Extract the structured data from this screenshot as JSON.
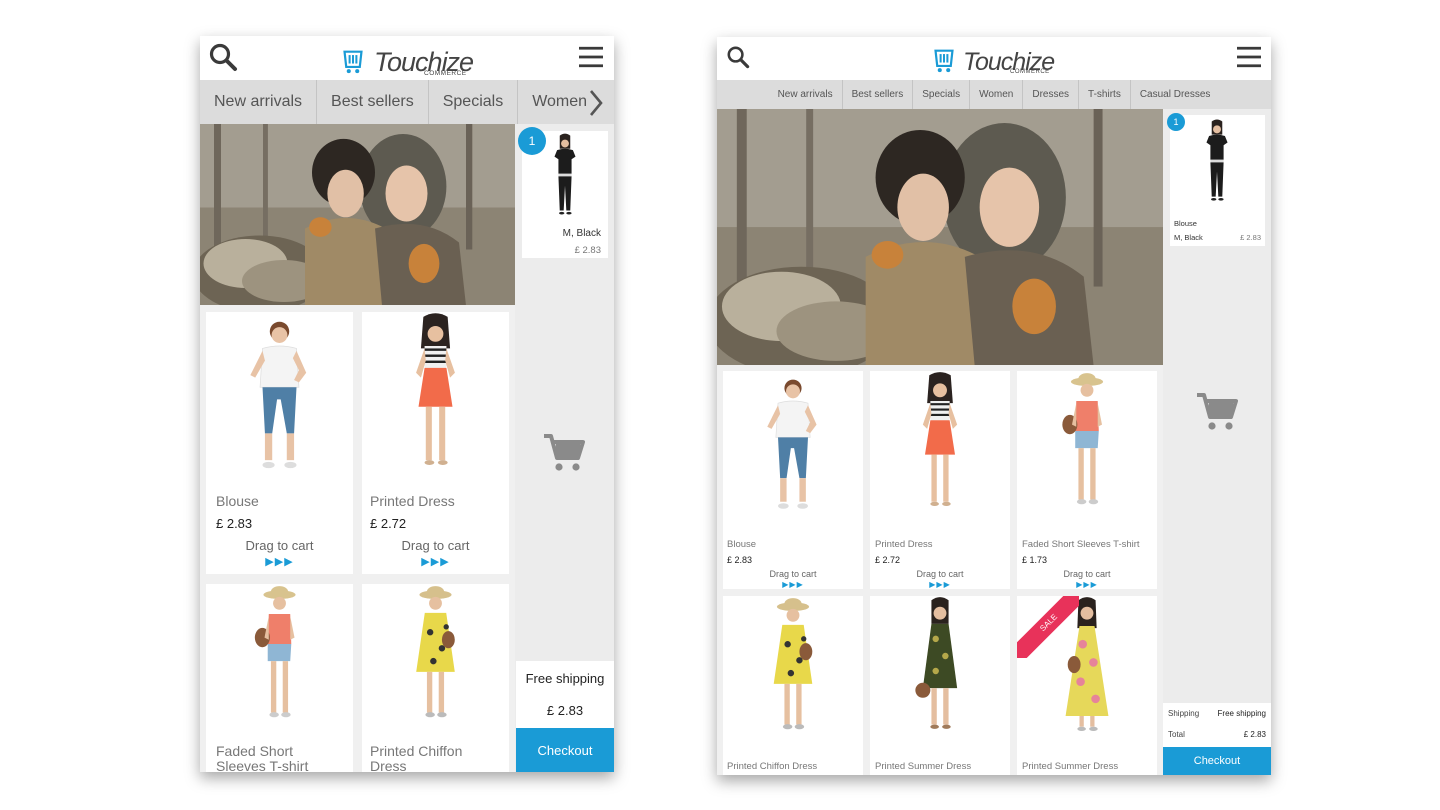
{
  "brand": {
    "name": "Touchize",
    "tagline": "COMMERCE"
  },
  "colors": {
    "accent": "#1a9bd6",
    "sale": "#e8325a",
    "navbar": "#dcdcdc",
    "panel": "#ececec"
  },
  "icons": {
    "search": "search-icon",
    "menu": "hamburger-menu-icon",
    "cart": "shopping-cart-icon",
    "next": "chevron-right-icon"
  },
  "phone": {
    "nav": [
      "New arrivals",
      "Best sellers",
      "Specials",
      "Women"
    ],
    "products": [
      {
        "name": "Blouse",
        "price": "£ 2.83",
        "drag": "Drag to cart",
        "arrows": "▶▶▶"
      },
      {
        "name": "Printed Dress",
        "price": "£ 2.72",
        "drag": "Drag to cart",
        "arrows": "▶▶▶"
      },
      {
        "name": "Faded Short Sleeves T-shirt"
      },
      {
        "name": "Printed Chiffon Dress"
      }
    ],
    "cart": {
      "count": "1",
      "item_name": "M, Black",
      "item_price": "£ 2.83",
      "shipping": "Free shipping",
      "total": "£ 2.83",
      "checkout": "Checkout"
    }
  },
  "tablet": {
    "nav": [
      "New arrivals",
      "Best sellers",
      "Specials",
      "Women",
      "Dresses",
      "T-shirts",
      "Casual Dresses"
    ],
    "products": [
      {
        "name": "Blouse",
        "price": "£ 2.83",
        "drag": "Drag to cart",
        "arrows": "▶▶▶"
      },
      {
        "name": "Printed Dress",
        "price": "£ 2.72",
        "drag": "Drag to cart",
        "arrows": "▶▶▶"
      },
      {
        "name": "Faded Short Sleeves T-shirt",
        "price": "£ 1.73",
        "drag": "Drag to cart",
        "arrows": "▶▶▶"
      },
      {
        "name": "Printed Chiffon Dress"
      },
      {
        "name": "Printed Summer Dress"
      },
      {
        "name": "Printed Summer Dress",
        "sale": "SALE"
      }
    ],
    "cart": {
      "count": "1",
      "item_title": "Blouse",
      "item_variant": "M, Black",
      "item_price": "£ 2.83",
      "shipping_label": "Shipping",
      "shipping_value": "Free shipping",
      "total_label": "Total",
      "total_value": "£ 2.83",
      "checkout": "Checkout"
    }
  }
}
